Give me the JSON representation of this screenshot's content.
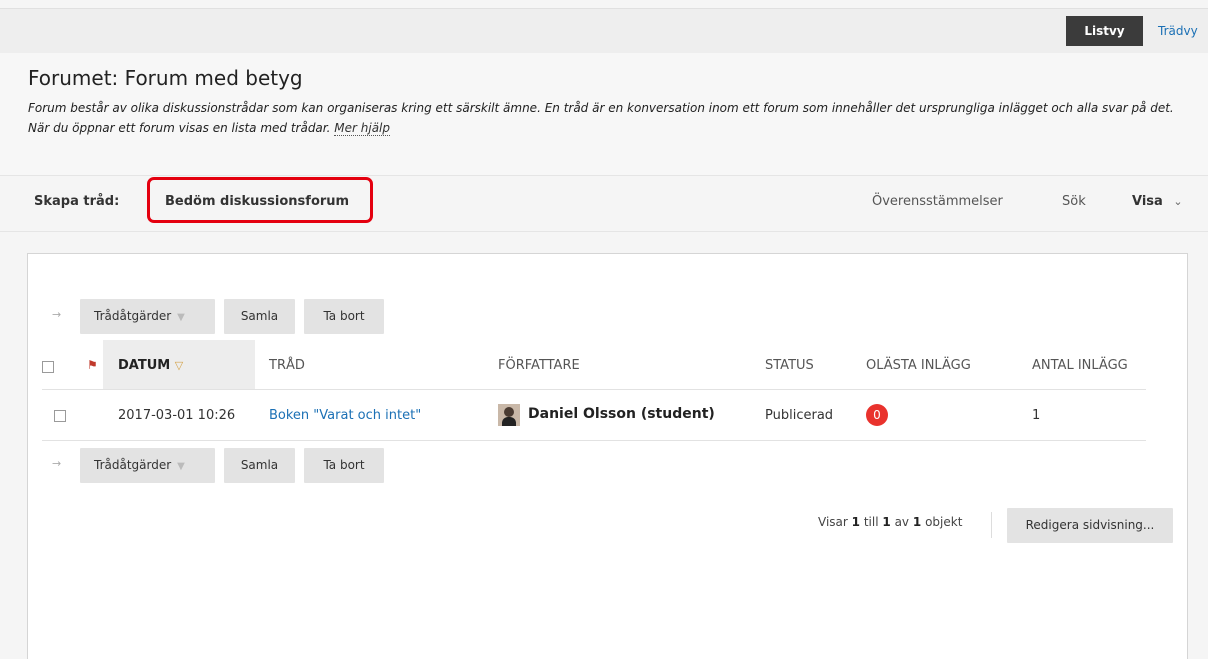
{
  "view_tabs": {
    "list": "Listvy",
    "tree": "Trädvy"
  },
  "forum": {
    "title": "Forumet: Forum med betyg",
    "description": "Forum består av olika diskussionstrådar som kan organiseras kring ett särskilt ämne. En tråd är en konversation inom ett forum som innehåller det ursprungliga inlägget och alla svar på det. När du öppnar ett forum visas en lista med trådar.",
    "help_link": "Mer hjälp"
  },
  "actionbar": {
    "create_thread": "Skapa tråd:",
    "grade_forum": "Bedöm diskussionsforum",
    "concordance": "Överensstämmelser",
    "search": "Sök",
    "show": "Visa"
  },
  "toolbar": {
    "thread_actions": "Trådåtgärder",
    "collect": "Samla",
    "delete": "Ta bort"
  },
  "table": {
    "headers": {
      "date": "DATUM",
      "thread": "TRÅD",
      "author": "FÖRFATTARE",
      "status": "STATUS",
      "unread": "OLÄSTA INLÄGG",
      "total": "ANTAL INLÄGG"
    },
    "rows": [
      {
        "date": "2017-03-01 10:26",
        "thread": "Boken \"Varat och intet\"",
        "author": "Daniel Olsson (student)",
        "status": "Publicerad",
        "unread": "0",
        "total": "1"
      }
    ]
  },
  "pager": {
    "prefix": "Visar",
    "from": "1",
    "till": "till",
    "to": "1",
    "of": "av",
    "total": "1",
    "suffix": "objekt",
    "edit": "Redigera sidvisning..."
  },
  "colors": {
    "link": "#1b70b5",
    "badge": "#e9322d",
    "highlight": "#e4000f",
    "active_tab": "#3b3b3b"
  }
}
